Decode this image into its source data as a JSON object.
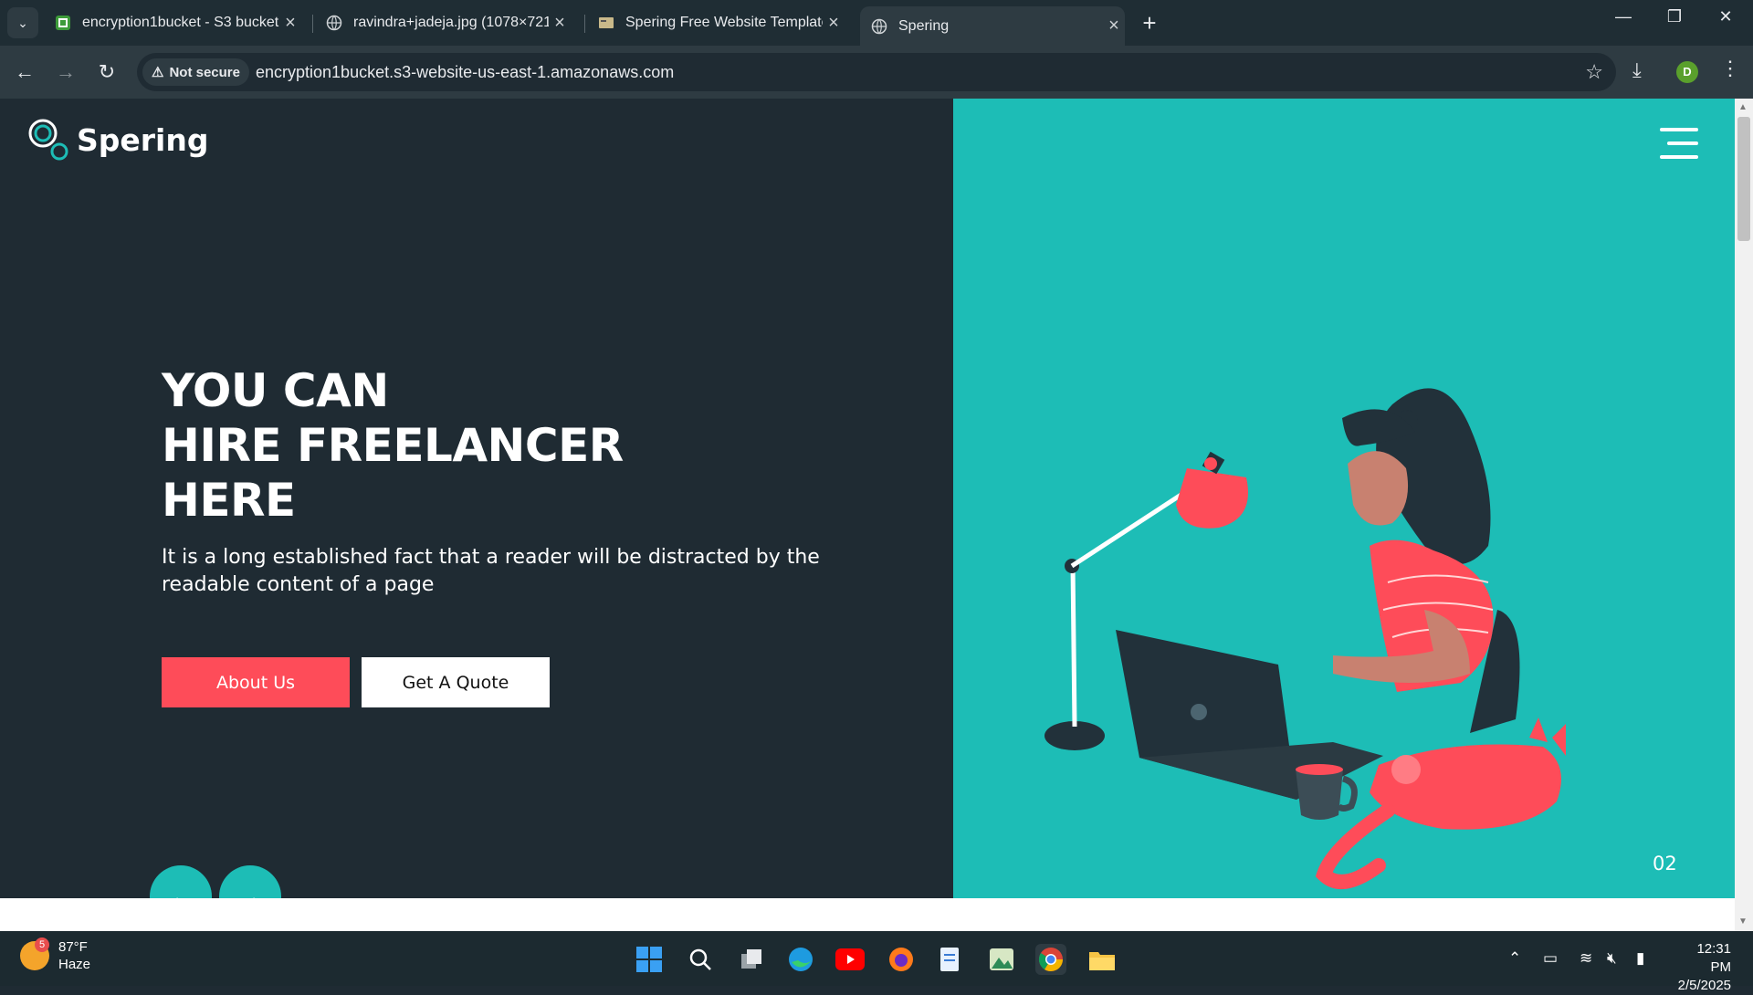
{
  "browser": {
    "tabs": [
      {
        "title": "encryption1bucket - S3 bucket |",
        "icon": "s3-icon",
        "active": false
      },
      {
        "title": "ravindra+jadeja.jpg (1078×721)",
        "icon": "globe-icon",
        "active": false
      },
      {
        "title": "Spering Free Website Template",
        "icon": "page-icon",
        "active": false
      },
      {
        "title": "Spering",
        "icon": "globe-icon",
        "active": true
      }
    ],
    "security_label": "Not secure",
    "url": "encryption1bucket.s3-website-us-east-1.amazonaws.com",
    "profile_initial": "D"
  },
  "page": {
    "logo_text": "Spering",
    "headline": [
      "YOU CAN",
      "HIRE FREELANCER",
      "HERE"
    ],
    "description": "It is a long established fact that a reader will be distracted by the readable content of a page",
    "buttons": {
      "about": "About Us",
      "quote": "Get A Quote"
    },
    "slide_number": "02",
    "colors": {
      "dark": "#1f2b33",
      "teal": "#1dbdb6",
      "accent": "#fe4c59"
    }
  },
  "taskbar": {
    "weather": {
      "temp": "87°F",
      "condition": "Haze",
      "badge": "5"
    },
    "apps": [
      "windows-start-icon",
      "search-icon",
      "task-view-icon",
      "edge-icon",
      "youtube-icon",
      "firefox-icon",
      "notepad-icon",
      "photos-icon",
      "chrome-icon",
      "file-explorer-icon"
    ],
    "time": "12:31 PM",
    "date": "2/5/2025"
  }
}
